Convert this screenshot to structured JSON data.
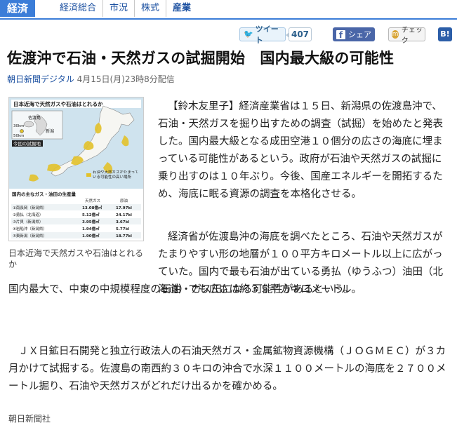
{
  "nav": {
    "active": "経済",
    "items": [
      "経済総合",
      "市況",
      "株式",
      "産業"
    ]
  },
  "share": {
    "tweet_label": "ツイート",
    "tweet_count": "407",
    "facebook_label": "シェア",
    "mixi_label": "チェック",
    "hatena_label": "B!"
  },
  "article": {
    "headline": "佐渡沖で石油・天然ガスの試掘開始　国内最大級の可能性",
    "source": "朝日新聞デジタル",
    "date": "4月15日(月)23時8分配信",
    "paragraph1": "【鈴木友里子】経済産業省は１５日、新潟県の佐渡島沖で、石油・天然ガスを掘り出すための調査（試掘）を始めたと発表した。国内最大級となる成田空港１０個分の広さの海底に埋まっている可能性があるという。政府が石油や天然ガスの試掘に乗り出すのは１０年ぶり。今後、国産エネルギーを開拓するため、海底に眠る資源の調査を本格化させる。",
    "paragraph2a": "経済省が佐渡島沖の海底を調べたところ、石油や天然ガスがたまりやすい形の地層が１００平方キロメートル以上に広がっていた。国内で最も石油が出ている勇払（ゆうふつ）油田（北海道）でも広さは約３５平方キロメートル。",
    "paragraph2b": "国内最大で、中東の中規模程度の石油・ガス田になる可能性があるという。",
    "paragraph3": "ＪＸ日鉱日石開発と独立行政法人の石油天然ガス・金属鉱物資源機構（ＪＯＧＭＥＣ）が３カ月かけて試掘する。佐渡島の南西約３０キロの沖合で水深１１００メートルの海底を２７００メートル掘り、石油や天然ガスがどれだけ出るかを確かめる。",
    "footer": "朝日新聞社"
  },
  "figure": {
    "caption": "日本近海で天然ガスや石油はとれるか",
    "map_title": "日本近海で天然ガスや石油はとれるか",
    "labels": [
      "佐渡島",
      "新潟",
      "30km",
      "50km",
      "今回の試掘地"
    ],
    "legend": "石油や天然ガスがたまっている可能性の高い場所",
    "table_title": "国内の主なガス・油田の生産量",
    "table_headers": [
      "",
      "天然ガス",
      "原油"
    ],
    "table_rows": [
      [
        "①南長岡（新潟県）",
        "13.08億㎥",
        "17.97kl"
      ],
      [
        "②勇払（北海道）",
        "5.12億㎥",
        "24.17kl"
      ],
      [
        "③片貝（新潟県）",
        "3.95億㎥",
        "3.67kl"
      ],
      [
        "④岩船沖（新潟県）",
        "1.94億㎥",
        "5.77kl"
      ],
      [
        "⑤東新潟（新潟県）",
        "1.90億㎥",
        "18.77kl"
      ]
    ]
  },
  "colors": {
    "accent": "#3b7dd8",
    "link": "#1a4fa0",
    "facebook": "#4a66a8",
    "hatena": "#2c5ea8",
    "resource": "#e2c12a"
  }
}
